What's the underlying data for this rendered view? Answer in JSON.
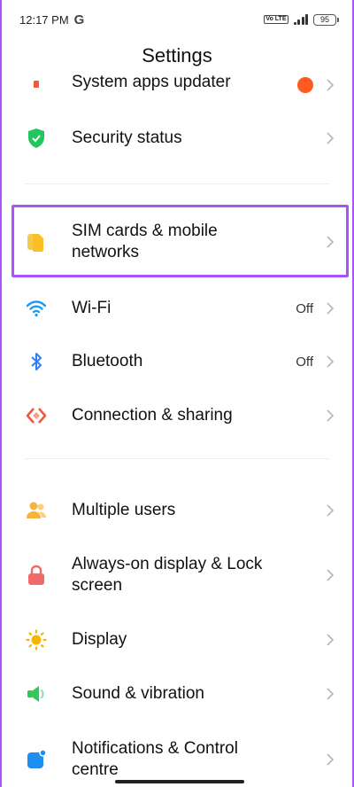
{
  "status_bar": {
    "time": "12:17 PM",
    "carrier_icon": "G",
    "network_badge": "Vo LTE",
    "battery": "95"
  },
  "header": {
    "title": "Settings"
  },
  "settings": {
    "items": [
      {
        "label": "System apps updater",
        "icon": "system-apps-icon"
      },
      {
        "label": "Security status",
        "icon": "shield-icon"
      },
      {
        "label": "SIM cards & mobile networks",
        "icon": "sim-card-icon"
      },
      {
        "label": "Wi-Fi",
        "value": "Off",
        "icon": "wifi-icon"
      },
      {
        "label": "Bluetooth",
        "value": "Off",
        "icon": "bluetooth-icon"
      },
      {
        "label": "Connection & sharing",
        "icon": "connection-sharing-icon"
      },
      {
        "label": "Multiple users",
        "icon": "users-icon"
      },
      {
        "label": "Always-on display & Lock screen",
        "icon": "lock-icon"
      },
      {
        "label": "Display",
        "icon": "sun-icon"
      },
      {
        "label": "Sound & vibration",
        "icon": "speaker-icon"
      },
      {
        "label": "Notifications & Control centre",
        "icon": "notification-icon"
      }
    ]
  },
  "colors": {
    "highlight": "#a855f7",
    "shield": "#22c55e",
    "sim": "#fbbf24",
    "wifi": "#1e9af0",
    "bluetooth": "#2d7ff9",
    "connection": "#f05a3c",
    "users": "#f6b43c",
    "lock": "#f06a6a",
    "display": "#f7b500",
    "sound": "#34c759",
    "notification": "#1e8ef0"
  }
}
